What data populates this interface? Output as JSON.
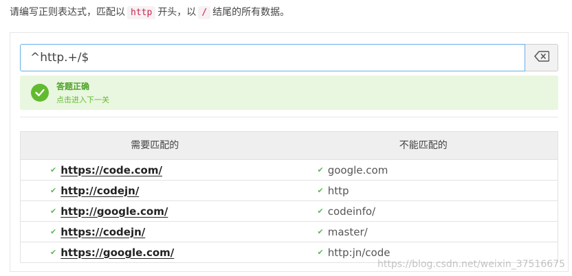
{
  "question": {
    "prefix": "请编写正则表达式，匹配以",
    "code1": "http",
    "middle": "开头，以",
    "code2": "/",
    "suffix": "结尾的所有数据。"
  },
  "regex": {
    "value": "^http.+/$"
  },
  "result": {
    "title": "答题正确",
    "subtitle": "点击进入下一关"
  },
  "table": {
    "headers": [
      "需要匹配的",
      "不能匹配的"
    ],
    "rows": [
      {
        "match": "https://code.com/",
        "nomatch": "google.com"
      },
      {
        "match": "http://codejn/",
        "nomatch": "http"
      },
      {
        "match": "http://google.com/",
        "nomatch": "codeinfo/"
      },
      {
        "match": "https://codejn/",
        "nomatch": "master/"
      },
      {
        "match": "https://google.com/",
        "nomatch": "http:jn/code"
      }
    ]
  },
  "watermark": "https://blog.csdn.net/weixin_37516675",
  "icons": {
    "clear": "backspace-icon",
    "success": "check-circle-icon",
    "row": "check-icon"
  },
  "colors": {
    "success_green": "#62bb2f",
    "input_border": "#66afe9",
    "code_red": "#c7254e"
  }
}
